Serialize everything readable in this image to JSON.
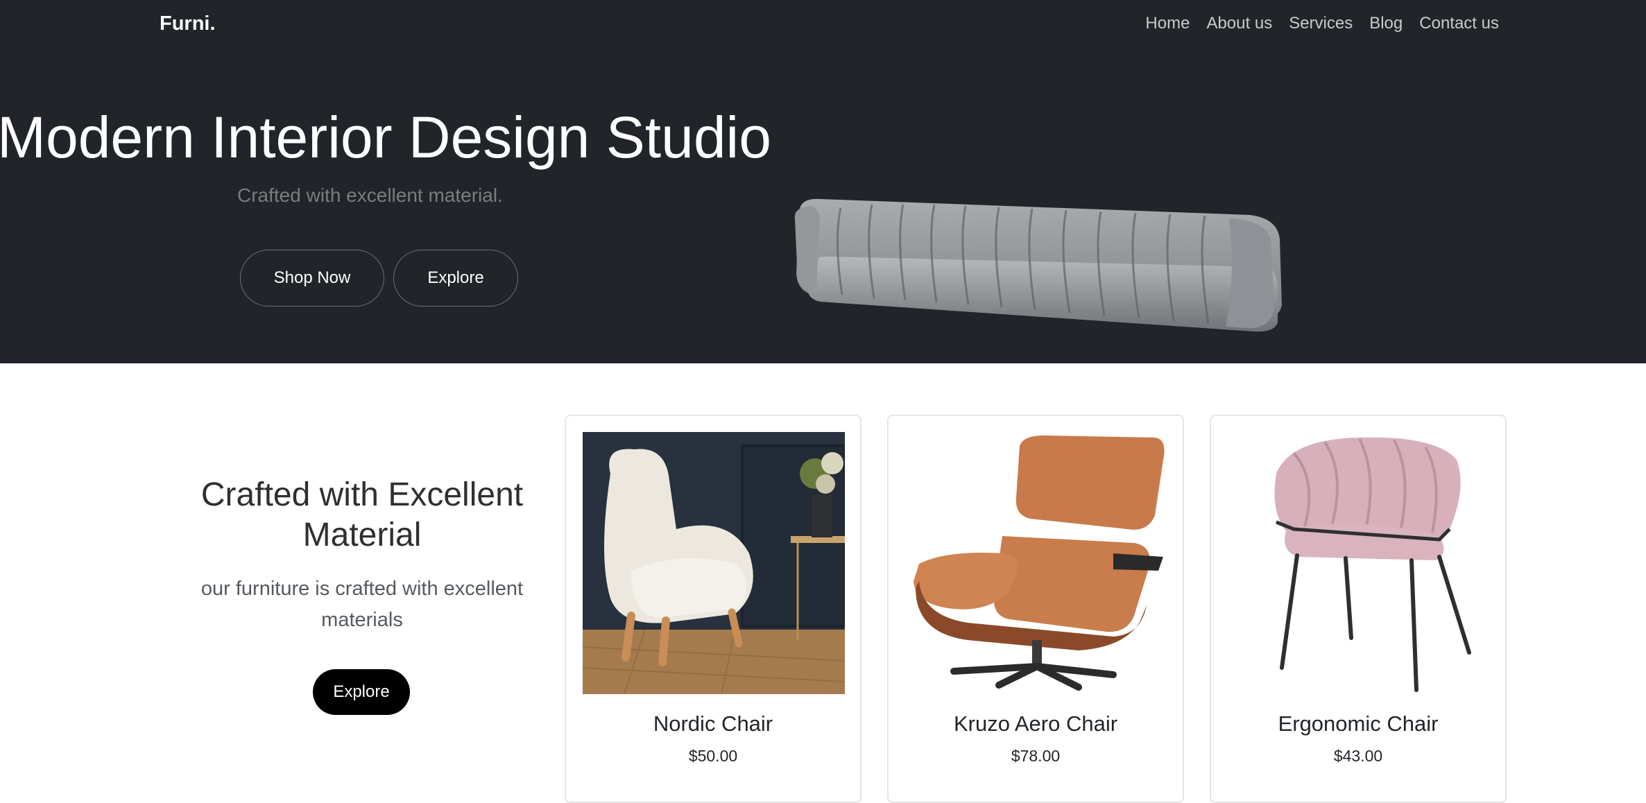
{
  "brand": "Furni.",
  "nav": [
    {
      "label": "Home"
    },
    {
      "label": "About us"
    },
    {
      "label": "Services"
    },
    {
      "label": "Blog"
    },
    {
      "label": "Contact us"
    }
  ],
  "hero": {
    "title": "Modern Interior Design Studio",
    "subtitle": "Crafted with excellent material.",
    "primary_button": "Shop Now",
    "secondary_button": "Explore"
  },
  "section": {
    "title": "Crafted with Excellent Material",
    "subtitle": "our furniture is crafted with excellent materials",
    "button": "Explore"
  },
  "products": [
    {
      "name": "Nordic Chair",
      "price": "$50.00"
    },
    {
      "name": "Kruzo Aero Chair",
      "price": "$78.00"
    },
    {
      "name": "Ergonomic Chair",
      "price": "$43.00"
    }
  ],
  "colors": {
    "hero_bg": "#212529",
    "text_dark": "#212529",
    "button_dark": "#000000"
  }
}
